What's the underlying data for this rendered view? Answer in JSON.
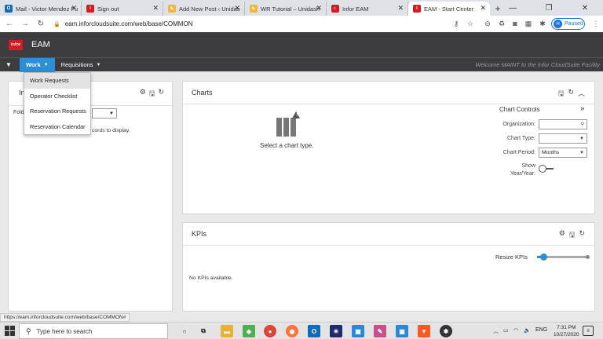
{
  "browser": {
    "tabs": [
      {
        "title": "Mail - Victor Mendez Fu",
        "icon": "outlook-icon",
        "color": "#0f6cbd",
        "glyph": "O"
      },
      {
        "title": "Sign out",
        "icon": "infor-icon",
        "color": "#d71920",
        "glyph": "i"
      },
      {
        "title": "Add New Post ‹ Unidas",
        "icon": "pencil-icon",
        "color": "#f2b632",
        "glyph": "✎"
      },
      {
        "title": "WR Tutorial – Unidash",
        "icon": "pencil-icon",
        "color": "#f2b632",
        "glyph": "✎"
      },
      {
        "title": "Infor EAM",
        "icon": "infor-icon",
        "color": "#d71920",
        "glyph": "◐"
      },
      {
        "title": "EAM - Start Center",
        "icon": "infor-icon",
        "color": "#d71920",
        "glyph": "i",
        "active": true
      }
    ],
    "url": "eam.inforcloudsuite.com/web/base/COMMON",
    "profile_initial": "H",
    "profile_status": "Paused"
  },
  "app": {
    "logo_text": "infor",
    "name": "EAM",
    "nav": {
      "work": "Work",
      "requisitions": "Requisitions"
    },
    "welcome": "Welcome MAINT to the Infor CloudSuite Facility",
    "work_menu": [
      "Work Requests",
      "Operator Checklist",
      "Reservation Requests",
      "Reservation Calendar"
    ]
  },
  "left_panel": {
    "title_visible": "In",
    "folder_label": "Fold",
    "records_text": "cords to display."
  },
  "charts": {
    "title": "Charts",
    "placeholder": "Select a chart type.",
    "controls": {
      "title": "Chart Controls",
      "organization_label": "Organization:",
      "organization_value": "",
      "chart_type_label": "Chart Type:",
      "chart_type_value": "",
      "chart_period_label": "Chart Period:",
      "chart_period_value": "Months",
      "show_year_label_1": "Show",
      "show_year_label_2": "Year/Year:"
    }
  },
  "kpis": {
    "title": "KPIs",
    "resize_label": "Resize KPIs",
    "resize_level": 0.12,
    "empty_text": "No KPIs available."
  },
  "status_url": "https://eam.inforcloudsuite.com/web/base/COMMON#",
  "taskbar": {
    "search_placeholder": "Type here to search",
    "language": "ENG",
    "time": "7:31 PM",
    "date": "10/27/2020"
  },
  "colors": {
    "accent": "#2c8fd6",
    "header": "#3c3c3f",
    "brand": "#d71920"
  }
}
